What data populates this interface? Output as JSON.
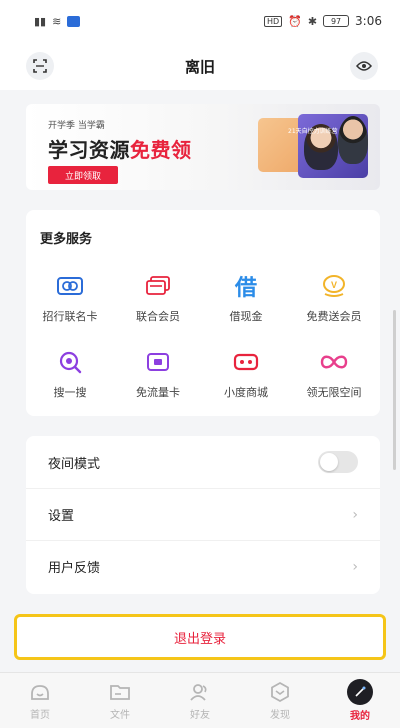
{
  "status_bar": {
    "left_indicators": [
      "signal-icon",
      "wifi-icon",
      "download-icon"
    ],
    "right_indicators": [
      "hd-badge",
      "alarm-icon",
      "bluetooth-icon"
    ],
    "hd": "HD",
    "battery": "97",
    "time": "3:06"
  },
  "header": {
    "title": "离旧",
    "left_icon": "scan-icon",
    "right_icon": "eye-icon"
  },
  "banner": {
    "tagline": "开学季 当学霸",
    "headline_prefix": "学习资源",
    "headline_highlight": "免费领",
    "cta": "立即领取",
    "art_title": "21天自控力训练营",
    "colors": {
      "accent": "#e8233d"
    }
  },
  "services": {
    "title": "更多服务",
    "items": [
      {
        "label": "招行联名卡",
        "icon": "bank-card-icon",
        "color": "#2b6cd8"
      },
      {
        "label": "联合会员",
        "icon": "member-card-icon",
        "color": "#e8233d"
      },
      {
        "label": "借现金",
        "icon": "borrow-cash-icon",
        "glyph": "借",
        "color": "#2b8ce8"
      },
      {
        "label": "免费送会员",
        "icon": "gift-member-icon",
        "color": "#f2b42a"
      },
      {
        "label": "搜一搜",
        "icon": "search-icon",
        "color": "#8c3fe0"
      },
      {
        "label": "免流量卡",
        "icon": "sim-card-icon",
        "color": "#8c3fe0"
      },
      {
        "label": "小度商城",
        "icon": "store-icon",
        "color": "#e8233d"
      },
      {
        "label": "领无限空间",
        "icon": "infinity-icon",
        "color": "#e83f8c"
      }
    ]
  },
  "settings": {
    "items": [
      {
        "label": "夜间模式",
        "type": "toggle",
        "value": false
      },
      {
        "label": "设置",
        "type": "link"
      },
      {
        "label": "用户反馈",
        "type": "link"
      }
    ]
  },
  "logout": {
    "label": "退出登录"
  },
  "tab_bar": {
    "items": [
      {
        "label": "首页",
        "icon": "home-icon",
        "active": false
      },
      {
        "label": "文件",
        "icon": "folder-icon",
        "active": false
      },
      {
        "label": "好友",
        "icon": "friends-icon",
        "active": false
      },
      {
        "label": "发现",
        "icon": "discover-icon",
        "active": false
      },
      {
        "label": "我的",
        "icon": "profile-icon",
        "active": true
      }
    ]
  }
}
